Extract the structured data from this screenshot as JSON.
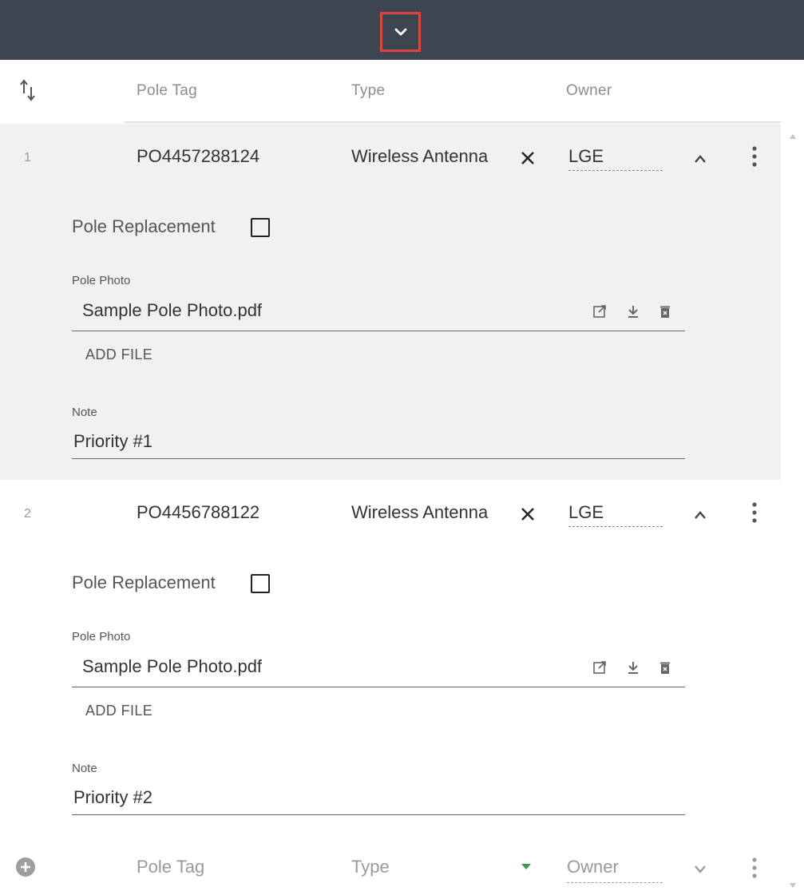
{
  "topbar": {
    "collapse_icon": "chevron-down-icon",
    "highlight_color": "#d9473f",
    "bg_color": "#3d4550"
  },
  "table_header": {
    "sort_icon": "sort-icon",
    "columns": [
      "Pole Tag",
      "Type",
      "Owner"
    ]
  },
  "rows": [
    {
      "number": "1",
      "pole_tag": "PO4457288124",
      "type": "Wireless Antenna",
      "owner": "LGE",
      "pole_replacement_label": "Pole Replacement",
      "pole_replacement_checked": false,
      "photo_label": "Pole Photo",
      "photo_file": "Sample Pole Photo.pdf",
      "add_file_label": "ADD FILE",
      "note_label": "Note",
      "note_value": "Priority #1"
    },
    {
      "number": "2",
      "pole_tag": "PO4456788122",
      "type": "Wireless Antenna",
      "owner": "LGE",
      "pole_replacement_label": "Pole Replacement",
      "pole_replacement_checked": false,
      "photo_label": "Pole Photo",
      "photo_file": "Sample Pole Photo.pdf",
      "add_file_label": "ADD FILE",
      "note_label": "Note",
      "note_value": "Priority #2"
    }
  ],
  "new_row": {
    "pole_tag_placeholder": "Pole Tag",
    "type_placeholder": "Type",
    "owner_placeholder": "Owner",
    "caret_color": "#3a9a5a"
  },
  "colors": {
    "row_alt_bg": "#f1f1f1",
    "checkbox_border": "#222222"
  }
}
